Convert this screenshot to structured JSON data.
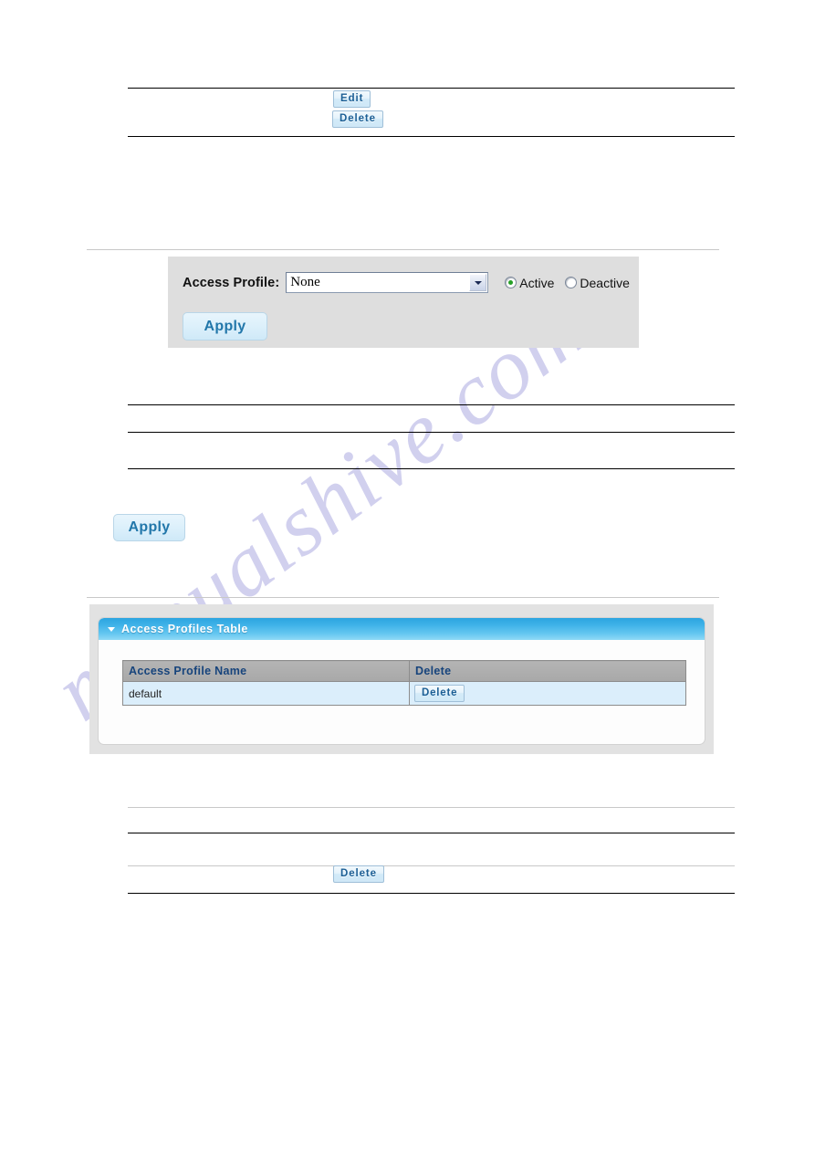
{
  "watermark": {
    "text": "manualshive.com"
  },
  "top_actions": {
    "edit_label": "Edit",
    "delete_label": "Delete"
  },
  "profile_form": {
    "label": "Access Profile:",
    "select_value": "None",
    "select_options": [
      "None"
    ],
    "radios": [
      {
        "label": "Active",
        "checked": true
      },
      {
        "label": "Deactive",
        "checked": false
      }
    ],
    "apply_label": "Apply"
  },
  "apply_button": {
    "label": "Apply"
  },
  "profiles_table": {
    "title": "Access Profiles Table",
    "columns": [
      "Access Profile Name",
      "Delete"
    ],
    "rows": [
      {
        "name": "default",
        "action_label": "Delete"
      }
    ]
  },
  "bottom_actions": {
    "delete_label": "Delete"
  },
  "colors": {
    "header_blue_start": "#2ba4e0",
    "header_blue_end": "#8fd9f6",
    "panel_gray": "#dedede",
    "row_blue": "#dbeefb",
    "button_text_blue": "#1c5f95",
    "radio_green": "#26a026",
    "watermark_lavender": "#c9c8ec"
  }
}
